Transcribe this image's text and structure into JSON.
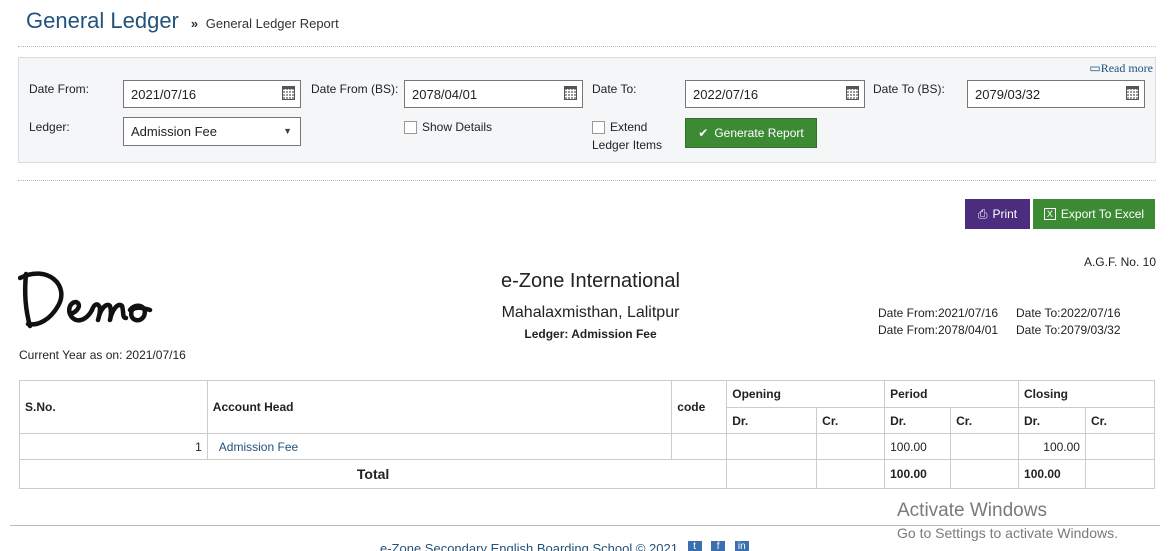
{
  "header": {
    "title": "General Ledger",
    "breadcrumb_sep": "»",
    "breadcrumb": "General Ledger Report"
  },
  "filters": {
    "read_more": "Read more",
    "date_from_label": "Date From:",
    "date_from": "2021/07/16",
    "date_from_bs_label": "Date From (BS):",
    "date_from_bs": "2078/04/01",
    "date_to_label": "Date To:",
    "date_to": "2022/07/16",
    "date_to_bs_label": "Date To (BS):",
    "date_to_bs": "2079/03/32",
    "ledger_label": "Ledger:",
    "ledger_value": "Admission Fee",
    "show_details": "Show Details",
    "extend_ledger_line1": "Extend",
    "extend_ledger_line2": "Ledger Items",
    "generate": "Generate Report"
  },
  "actions": {
    "print": "Print",
    "export": "Export To Excel"
  },
  "report": {
    "agf": "A.G.F. No. 10",
    "logo_text": "Demo",
    "org_name": "e-Zone International",
    "address": "Mahalaxmisthan, Lalitpur",
    "ledger_line": "Ledger: Admission Fee",
    "date_from_ad": "Date From:2021/07/16",
    "date_to_ad": "Date To:2022/07/16",
    "date_from_bs": "Date From:2078/04/01",
    "date_to_bs": "Date To:2079/03/32",
    "current_year": "Current Year as on: 2021/07/16"
  },
  "table": {
    "headers": {
      "sno": "S.No.",
      "account_head": "Account Head",
      "code": "code",
      "opening": "Opening",
      "period": "Period",
      "closing": "Closing",
      "dr": "Dr.",
      "cr": "Cr."
    },
    "rows": [
      {
        "sno": "1",
        "account_head": "Admission Fee",
        "code": "",
        "opening_dr": "",
        "opening_cr": "",
        "period_dr": "100.00",
        "period_cr": "",
        "closing_dr": "100.00",
        "closing_cr": ""
      }
    ],
    "total": {
      "label": "Total",
      "period_dr": "100.00",
      "closing_dr": "100.00"
    }
  },
  "footer": {
    "text": "e-Zone Secondary English Boarding School © 2021"
  },
  "watermark": {
    "line1": "Activate Windows",
    "line2": "Go to Settings to activate Windows."
  },
  "colors": {
    "primary_link": "#23527c",
    "success": "#3c8a34",
    "print": "#4b2c7f"
  }
}
